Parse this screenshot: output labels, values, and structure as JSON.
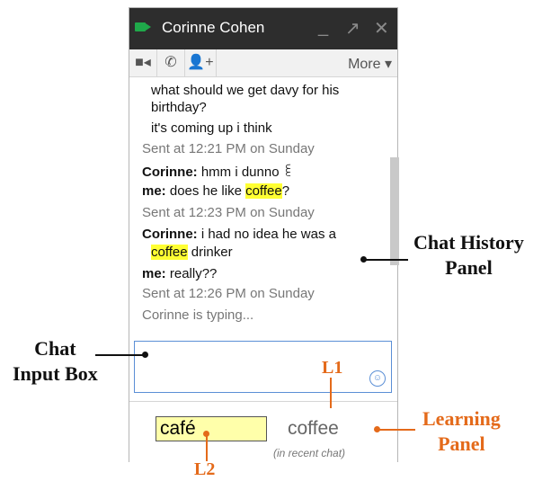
{
  "window": {
    "title": "Corinne Cohen",
    "controls": {
      "minimize": "_",
      "popout": "↗",
      "close": "✕"
    },
    "toolbar": {
      "more_label": "More ▾"
    }
  },
  "history": {
    "lines": [
      {
        "text": "what should we get davy for his"
      },
      {
        "text": "birthday?"
      },
      {
        "text": "it's coming up i think"
      },
      {
        "text": "Sent at 12:21 PM on Sunday"
      },
      {
        "sender": "Corinne:",
        "text": "hmm i dunno ꒲"
      },
      {
        "sender": "me:",
        "pre": "does he like ",
        "hl": "coffee",
        "post": "?"
      },
      {
        "text": "Sent at 12:23 PM on Sunday"
      },
      {
        "sender": "Corinne:",
        "text": "i had no idea he was a"
      },
      {
        "hl": "coffee",
        "post": " drinker"
      },
      {
        "sender": "me:",
        "text": "really??"
      },
      {
        "text": "Sent at 12:26 PM on Sunday"
      },
      {
        "text": "Corinne is typing..."
      }
    ]
  },
  "learning": {
    "word": "café",
    "translation": "coffee",
    "note": "(in recent chat)"
  },
  "annotations": {
    "chat_history": [
      "Chat History",
      "Panel"
    ],
    "chat_input": [
      "Chat",
      "Input Box"
    ],
    "learning_panel": [
      "Learning",
      "Panel"
    ],
    "l1": "L1",
    "l2": "L2"
  },
  "colors": {
    "accent": "#e46a1a",
    "highlight": "#ffff33",
    "titlebar": "#2d2d2d"
  }
}
